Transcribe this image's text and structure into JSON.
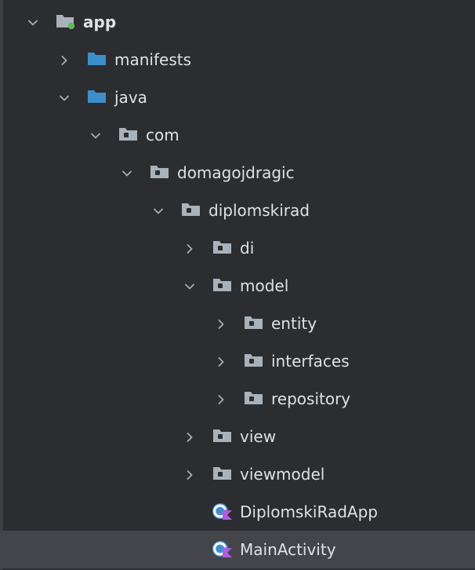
{
  "project_tree": {
    "items": [
      {
        "label": "app",
        "depth": 0,
        "expanded": true,
        "kind": "module"
      },
      {
        "label": "manifests",
        "depth": 1,
        "expanded": false,
        "kind": "source-folder"
      },
      {
        "label": "java",
        "depth": 1,
        "expanded": true,
        "kind": "source-folder"
      },
      {
        "label": "com",
        "depth": 2,
        "expanded": true,
        "kind": "package"
      },
      {
        "label": "domagojdragic",
        "depth": 3,
        "expanded": true,
        "kind": "package"
      },
      {
        "label": "diplomskirad",
        "depth": 4,
        "expanded": true,
        "kind": "package"
      },
      {
        "label": "di",
        "depth": 5,
        "expanded": false,
        "kind": "package"
      },
      {
        "label": "model",
        "depth": 5,
        "expanded": true,
        "kind": "package"
      },
      {
        "label": "entity",
        "depth": 6,
        "expanded": false,
        "kind": "package"
      },
      {
        "label": "interfaces",
        "depth": 6,
        "expanded": false,
        "kind": "package"
      },
      {
        "label": "repository",
        "depth": 6,
        "expanded": false,
        "kind": "package"
      },
      {
        "label": "view",
        "depth": 5,
        "expanded": false,
        "kind": "package"
      },
      {
        "label": "viewmodel",
        "depth": 5,
        "expanded": false,
        "kind": "package"
      },
      {
        "label": "DiplomskiRadApp",
        "depth": 5,
        "expanded": null,
        "kind": "kotlin-class"
      },
      {
        "label": "MainActivity",
        "depth": 5,
        "expanded": null,
        "kind": "kotlin-class",
        "selected": true
      }
    ]
  },
  "colors": {
    "background": "#2b2d30",
    "selection": "#43454a",
    "text": "#dfe1e5",
    "arrow": "#a8adb3",
    "folder_blue": "#3d8fcb",
    "folder_gray": "#a9b2bb",
    "module_dot": "#5fb85b",
    "kotlin_blue": "#3b8fd9",
    "kotlin_purple": "#b35ae0"
  }
}
